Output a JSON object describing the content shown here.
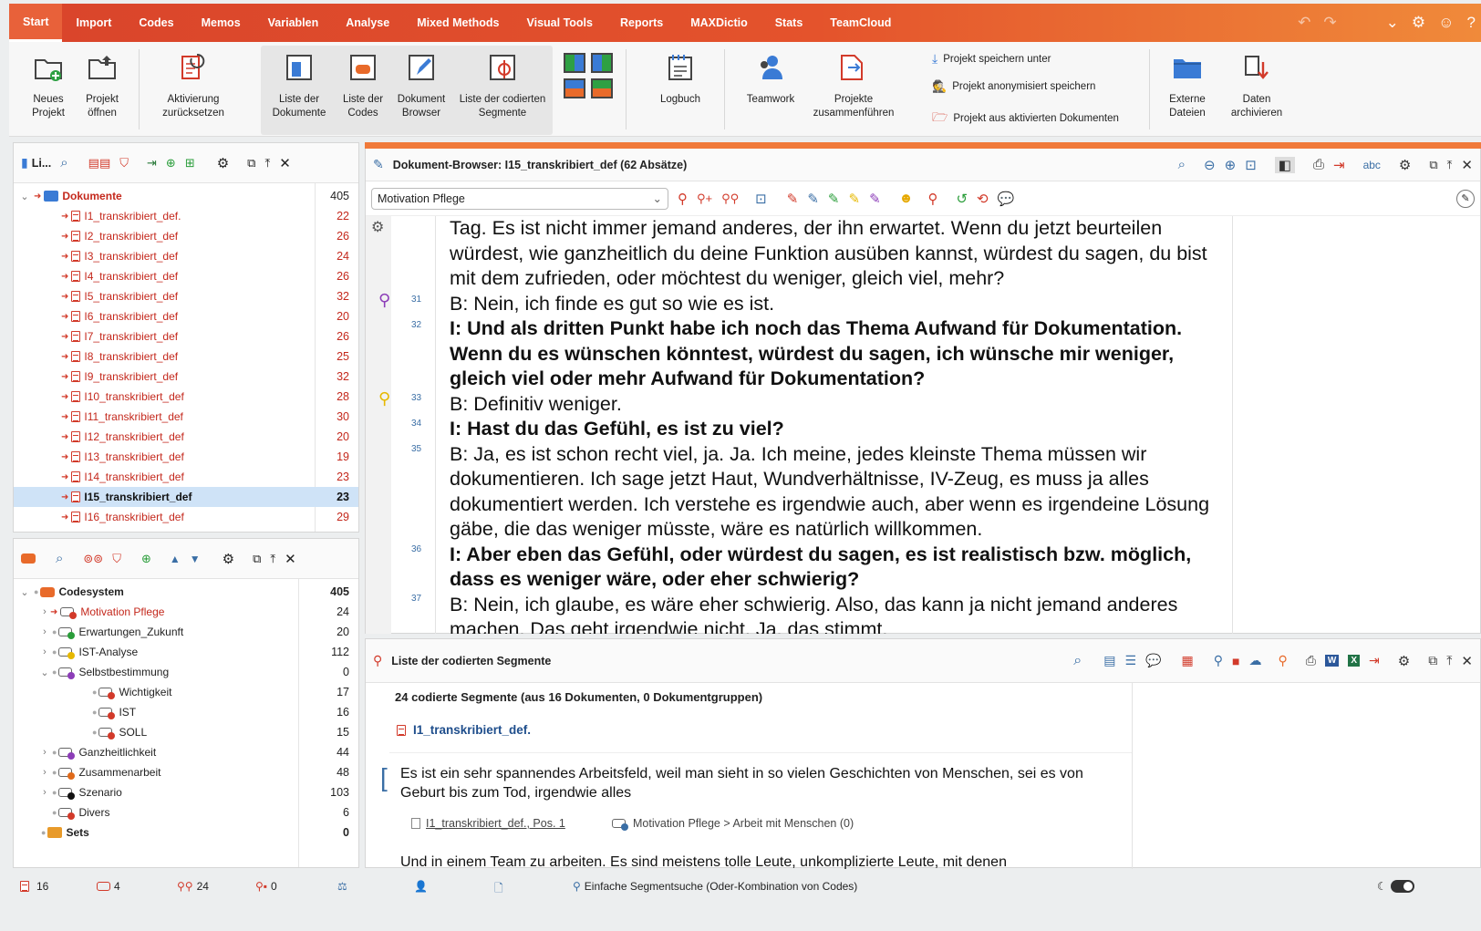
{
  "menu": {
    "tabs": [
      "Start",
      "Import",
      "Codes",
      "Memos",
      "Variablen",
      "Analyse",
      "Mixed Methods",
      "Visual Tools",
      "Reports",
      "MAXDictio",
      "Stats",
      "TeamCloud"
    ]
  },
  "ribbon": {
    "neues_projekt": "Neues\nProjekt",
    "projekt_oeffnen": "Projekt\nöffnen",
    "aktivierung": "Aktivierung\nzurücksetzen",
    "liste_dokumente": "Liste der\nDokumente",
    "liste_codes": "Liste der\nCodes",
    "dokument_browser": "Dokument\nBrowser",
    "liste_segmente": "Liste der codierten\nSegmente",
    "logbuch": "Logbuch",
    "teamwork": "Teamwork",
    "projekte_zus": "Projekte\nzusammenführen",
    "speichern_unter": "Projekt speichern unter",
    "anonymisiert": "Projekt anonymisiert speichern",
    "aus_aktivierten": "Projekt aus aktivierten Dokumenten",
    "externe": "Externe\nDateien",
    "archivieren": "Daten\narchivieren"
  },
  "doclist": {
    "title": "Li...",
    "root": {
      "label": "Dokumente",
      "count": "405"
    },
    "items": [
      {
        "label": "I1_transkribiert_def.",
        "count": "22"
      },
      {
        "label": "I2_transkribiert_def",
        "count": "26"
      },
      {
        "label": "I3_transkribiert_def",
        "count": "24"
      },
      {
        "label": "I4_transkribiert_def",
        "count": "26"
      },
      {
        "label": "I5_transkribiert_def",
        "count": "32"
      },
      {
        "label": "I6_transkribiert_def",
        "count": "20"
      },
      {
        "label": "I7_transkribiert_def",
        "count": "26"
      },
      {
        "label": "I8_transkribiert_def",
        "count": "25"
      },
      {
        "label": "I9_transkribiert_def",
        "count": "32"
      },
      {
        "label": "I10_transkribiert_def",
        "count": "28"
      },
      {
        "label": "I11_transkribiert_def",
        "count": "30"
      },
      {
        "label": "I12_transkribiert_def",
        "count": "20"
      },
      {
        "label": "I13_transkribiert_def",
        "count": "19"
      },
      {
        "label": "I14_transkribiert_def",
        "count": "23"
      },
      {
        "label": "I15_transkribiert_def",
        "count": "23"
      },
      {
        "label": "I16_transkribiert_def",
        "count": "29"
      }
    ]
  },
  "codesystem": {
    "root": {
      "label": "Codesystem",
      "count": "405"
    },
    "items": [
      {
        "label": "Motivation Pflege",
        "count": "24",
        "dot": "#d23a2a",
        "chev": "›",
        "indent": 1,
        "red": true
      },
      {
        "label": "Erwartungen_Zukunft",
        "count": "20",
        "dot": "#2a9d3a",
        "chev": "›",
        "indent": 1
      },
      {
        "label": "IST-Analyse",
        "count": "112",
        "dot": "#e6b800",
        "chev": "›",
        "indent": 1
      },
      {
        "label": "Selbstbestimmung",
        "count": "0",
        "dot": "#8c3db8",
        "chev": "⌄",
        "indent": 1
      },
      {
        "label": "Wichtigkeit",
        "count": "17",
        "dot": "#d23a2a",
        "chev": "",
        "indent": 2
      },
      {
        "label": "IST",
        "count": "16",
        "dot": "#d23a2a",
        "chev": "",
        "indent": 2
      },
      {
        "label": "SOLL",
        "count": "15",
        "dot": "#d23a2a",
        "chev": "",
        "indent": 2
      },
      {
        "label": "Ganzheitlichkeit",
        "count": "44",
        "dot": "#8c3db8",
        "chev": "›",
        "indent": 1
      },
      {
        "label": "Zusammenarbeit",
        "count": "48",
        "dot": "#e06a1a",
        "chev": "›",
        "indent": 1
      },
      {
        "label": "Szenario",
        "count": "103",
        "dot": "#111111",
        "chev": "›",
        "indent": 1
      },
      {
        "label": "Divers",
        "count": "6",
        "dot": "#d23a2a",
        "chev": "",
        "indent": 1
      }
    ],
    "sets": {
      "label": "Sets",
      "count": "0"
    }
  },
  "browser": {
    "title": "Dokument-Browser: I15_transkribiert_def  (62 Absätze)",
    "code_select": "Motivation Pflege",
    "paragraphs": [
      {
        "pos": "",
        "bold": false,
        "text": "Tag. Es ist nicht immer jemand anderes, der ihn erwartet. Wenn du jetzt beurteilen würdest, wie ganzheitlich du deine Funktion ausüben kannst, würdest du sagen, du bist mit dem zufrieden, oder möchtest du weniger, gleich viel, mehr?"
      },
      {
        "pos": "31",
        "bold": false,
        "text": "B: Nein, ich finde es gut so wie es ist."
      },
      {
        "pos": "32",
        "bold": true,
        "text": "I: Und als dritten Punkt habe ich noch das Thema Aufwand für Dokumentation. Wenn du es wünschen könntest, würdest du sagen, ich wünsche mir weniger, gleich viel oder mehr Aufwand für Dokumentation?"
      },
      {
        "pos": "33",
        "bold": false,
        "text": "B: Definitiv weniger."
      },
      {
        "pos": "34",
        "bold": true,
        "text": "I: Hast du das Gefühl, es ist zu viel?"
      },
      {
        "pos": "35",
        "bold": false,
        "text": "B: Ja, es ist schon recht viel, ja. Ja. Ich meine, jedes kleinste Thema müssen wir dokumentieren. Ich sage jetzt Haut, Wundverhältnisse, IV-Zeug, es muss ja alles dokumentiert werden. Ich verstehe es irgendwie auch, aber wenn es irgendeine Lösung gäbe, die das weniger müsste, wäre es natürlich willkommen."
      },
      {
        "pos": "36",
        "bold": true,
        "text": "I: Aber eben das Gefühl, oder würdest du sagen, es ist realistisch bzw. möglich, dass es weniger wäre, oder eher schwierig?"
      },
      {
        "pos": "37",
        "bold": false,
        "text": "B: Nein, ich glaube, es wäre eher schwierig. Also, das kann ja nicht jemand anderes machen. Das geht irgendwie nicht. Ja, das stimmt."
      }
    ]
  },
  "segments": {
    "title": "Liste der codierten Segmente",
    "summary": "24 codierte Segmente (aus 16 Dokumenten, 0 Dokumentgruppen)",
    "doc": "I1_transkribiert_def.",
    "seg1_text": "Es ist ein sehr spannendes Arbeitsfeld, weil man sieht in so vielen Geschichten von Menschen, sei es von Geburt bis zum Tod, irgendwie alles",
    "seg1_src": "I1_transkribiert_def., Pos. 1",
    "seg1_code": "Motivation Pflege > Arbeit mit Menschen (0)",
    "seg2_text": "Und in einem Team zu arbeiten. Es sind meistens tolle Leute, unkomplizierte Leute, mit denen"
  },
  "status": {
    "docs": "16",
    "codes": "4",
    "segments": "24",
    "memos": "0",
    "search": "Einfache Segmentsuche (Oder-Kombination von Codes)"
  }
}
